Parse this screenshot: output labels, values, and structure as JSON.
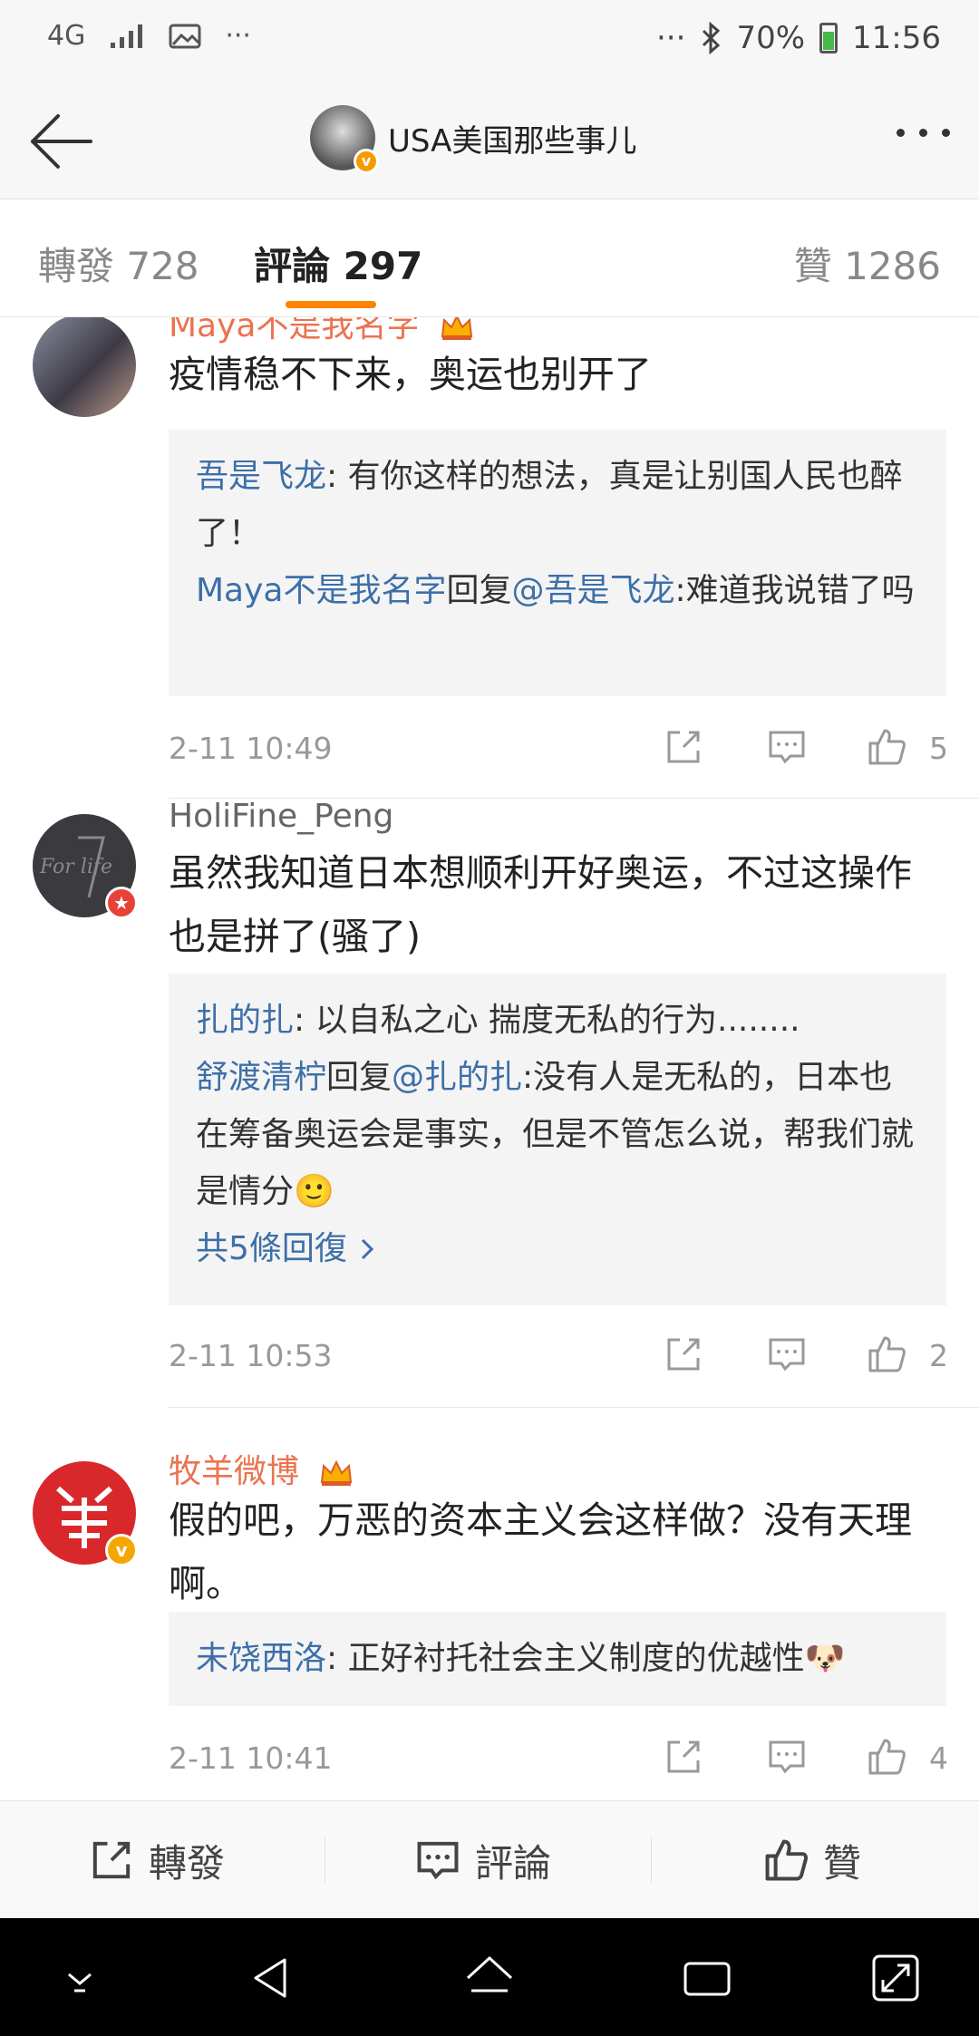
{
  "status_bar": {
    "network": "4G",
    "dots_left": "···",
    "dots_right": "···",
    "battery": "70%",
    "time": "11:56"
  },
  "nav": {
    "title": "USA美国那些事儿"
  },
  "tabs": [
    {
      "label": "轉發 728"
    },
    {
      "label": "評論 297"
    },
    {
      "label": "贊 1286"
    }
  ],
  "comments": [
    {
      "username": "Maya不是我名字",
      "text": "疫情稳不下来，奥运也别开了",
      "replies": [
        {
          "name": "吾是飞龙",
          "sep": ": ",
          "text": "有你这样的想法，真是让别国人民也醉了！"
        },
        {
          "name": "Maya不是我名字",
          "reply_word": "回复",
          "mention": "@吾是飞龙",
          "text": ":难道我说错了吗"
        }
      ],
      "time": "2-11 10:49",
      "likes": "5"
    },
    {
      "username": "HoliFine_Peng",
      "avatar_text": "For life",
      "text": "虽然我知道日本想顺利开好奥运，不过这操作也是拼了(骚了)",
      "replies": [
        {
          "name": "扎的扎",
          "sep": ": ",
          "text": "以自私之心 揣度无私的行为........"
        },
        {
          "name": "舒渡清柠",
          "reply_word": "回复",
          "mention": "@扎的扎",
          "text": ":没有人是无私的，日本也在筹备奥运会是事实，但是不管怎么说，帮我们就是情分🙂"
        }
      ],
      "more_replies": "共5條回復",
      "time": "2-11 10:53",
      "likes": "2"
    },
    {
      "username": "牧羊微博",
      "text": "假的吧，万恶的资本主义会这样做？没有天理啊。",
      "replies": [
        {
          "name": "未饶西洛",
          "sep": ": ",
          "text": "正好衬托社会主义制度的优越性🐶"
        }
      ],
      "time": "2-11 10:41",
      "likes": "4"
    }
  ],
  "bottom_bar": {
    "repost": "轉發",
    "comment": "評論",
    "like": "贊"
  },
  "colors": {
    "accent": "#ff8200",
    "username_orange": "#eb7350",
    "link_blue": "#3d6fa8",
    "reply_bg": "#f4f4f4"
  }
}
